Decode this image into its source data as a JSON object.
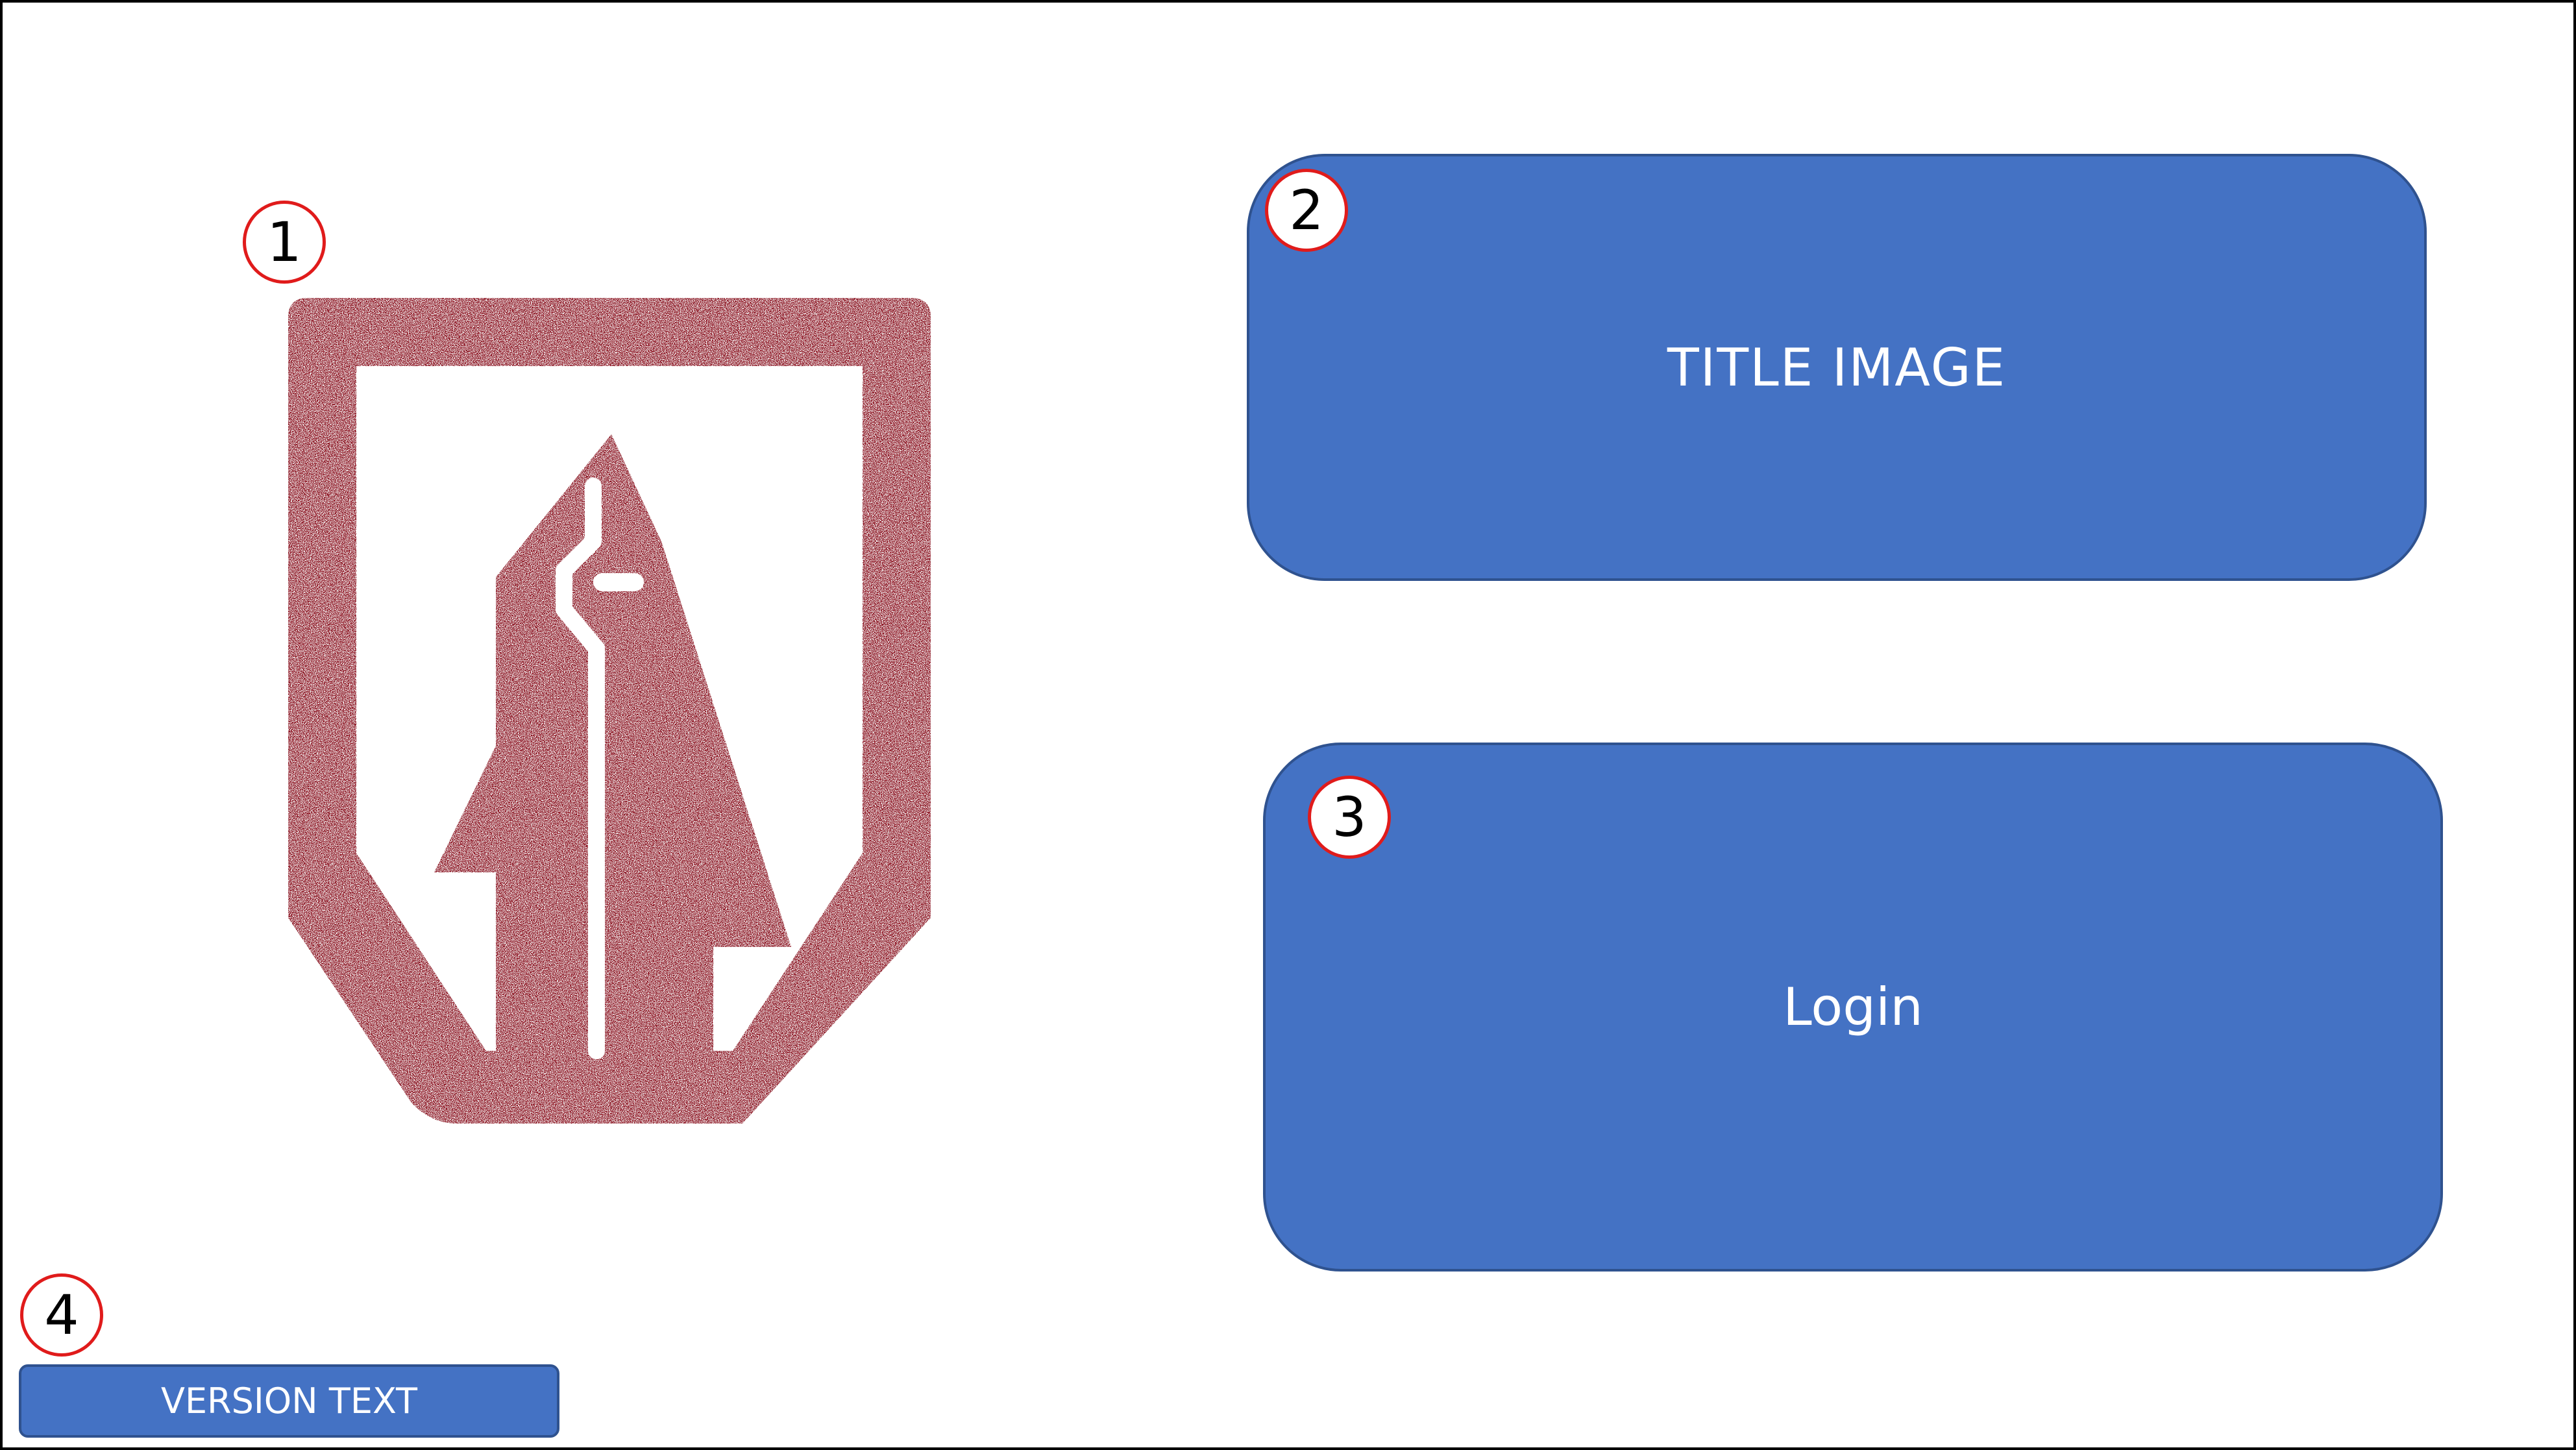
{
  "markers": {
    "logo": "1",
    "title_image": "2",
    "login": "3",
    "version_text": "4"
  },
  "logo": {
    "icon": "hooded-figure-shield-icon",
    "color": "#8b0f1a"
  },
  "title_panel": {
    "label": "TITLE IMAGE"
  },
  "login_panel": {
    "label": "Login"
  },
  "version_bar": {
    "label": "VERSION TEXT"
  },
  "colors": {
    "panel_fill": "#4472c4",
    "panel_border": "#2f528f",
    "marker_ring": "#e01b1b",
    "frame_border": "#000000"
  }
}
